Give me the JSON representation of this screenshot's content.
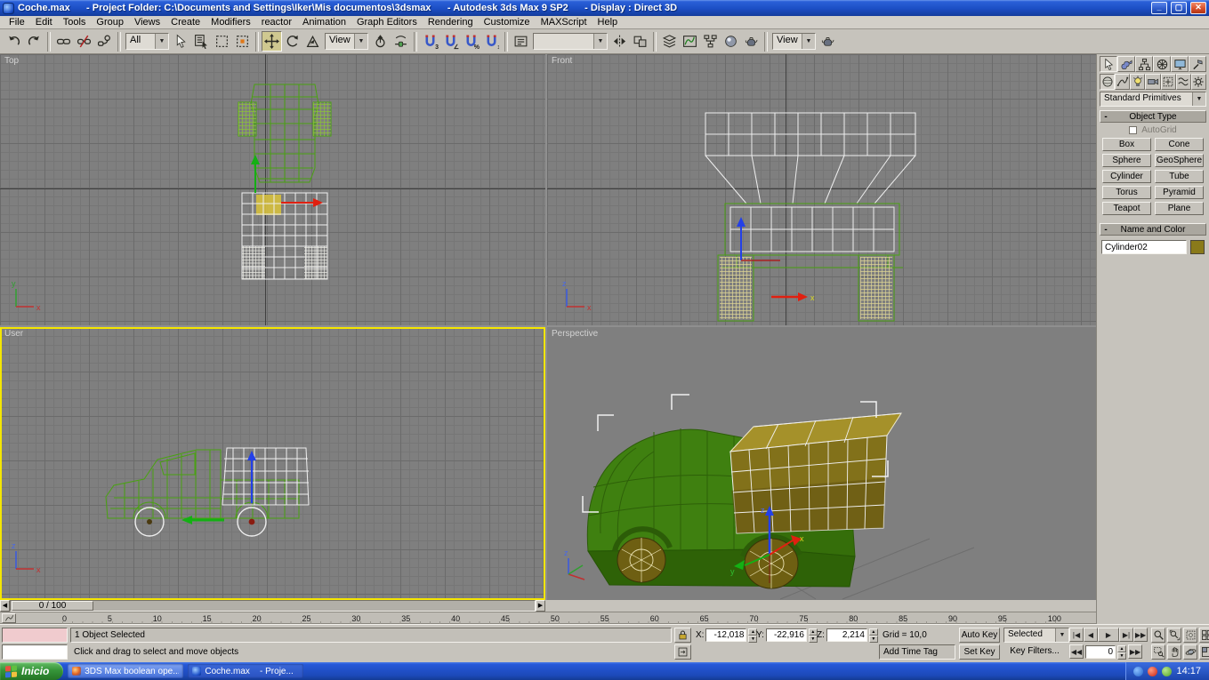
{
  "colors": {
    "selection-outline": "#f5e600",
    "wire-green": "#4aa212",
    "wire-white": "#efefef",
    "object-olive": "#8a7a1a",
    "gizmo-red": "#e02010",
    "gizmo-green": "#14b014",
    "gizmo-blue": "#2340e8"
  },
  "window": {
    "title": "Coche.max      - Project Folder: C:\\Documents and Settings\\Iker\\Mis documentos\\3dsmax      - Autodesk 3ds Max 9 SP2      - Display : Direct 3D"
  },
  "menu": {
    "items": [
      "File",
      "Edit",
      "Tools",
      "Group",
      "Views",
      "Create",
      "Modifiers",
      "reactor",
      "Animation",
      "Graph Editors",
      "Rendering",
      "Customize",
      "MAXScript",
      "Help"
    ]
  },
  "toolbar": {
    "selection_filter": "All",
    "reference_coordsys": "View",
    "render_preset": "View",
    "named_selection": ""
  },
  "viewports": {
    "top_label": "Top",
    "front_label": "Front",
    "user_label": "User",
    "perspective_label": "Perspective",
    "axis": {
      "x": "x",
      "y": "y",
      "z": "z"
    }
  },
  "command_panel": {
    "category_dropdown": "Standard Primitives",
    "object_type": {
      "title": "Object Type",
      "autogrid": "AutoGrid",
      "buttons": [
        "Box",
        "Cone",
        "Sphere",
        "GeoSphere",
        "Cylinder",
        "Tube",
        "Torus",
        "Pyramid",
        "Teapot",
        "Plane"
      ]
    },
    "name_color": {
      "title": "Name and Color",
      "object_name": "Cylinder02"
    }
  },
  "timeline": {
    "slider_label": "0 / 100",
    "ticks": [
      "0",
      "5",
      "10",
      "15",
      "20",
      "25",
      "30",
      "35",
      "40",
      "45",
      "50",
      "55",
      "60",
      "65",
      "70",
      "75",
      "80",
      "85",
      "90",
      "95",
      "100"
    ]
  },
  "status_bar": {
    "selection_info": "1 Object Selected",
    "prompt": "Click and drag to select and move objects",
    "x_label": "X:",
    "x_value": "-12,018",
    "y_label": "Y:",
    "y_value": "-22,916",
    "z_label": "Z:",
    "z_value": "2,214",
    "grid_info": "Grid = 10,0",
    "add_time_tag": "Add Time Tag",
    "auto_key": "Auto Key",
    "set_key": "Set Key",
    "key_mode": "Selected",
    "key_filters": "Key Filters...",
    "time_value": "0"
  },
  "taskbar": {
    "start_label": "Inicio",
    "tasks": [
      "3DS Max boolean ope...",
      "Coche.max    - Proje..."
    ],
    "clock": "14:17"
  }
}
